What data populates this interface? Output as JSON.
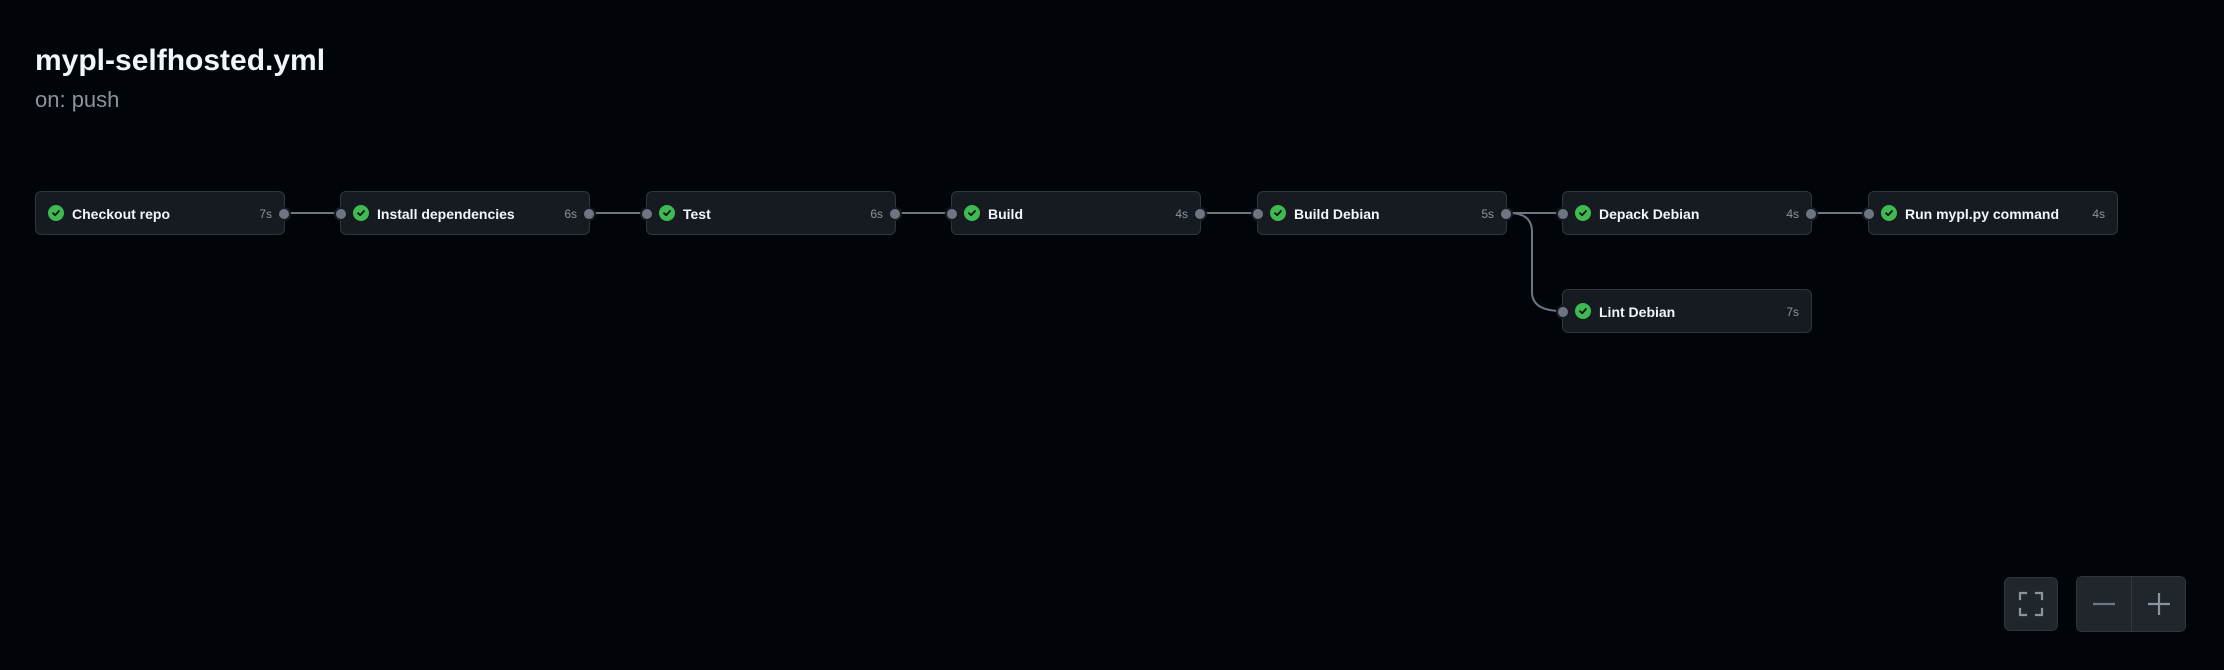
{
  "workflow": {
    "title": "mypl-selfhosted.yml",
    "trigger": "on: push"
  },
  "jobs": [
    {
      "name": "Checkout repo",
      "duration": "7s",
      "status": "success"
    },
    {
      "name": "Install dependencies",
      "duration": "6s",
      "status": "success"
    },
    {
      "name": "Test",
      "duration": "6s",
      "status": "success"
    },
    {
      "name": "Build",
      "duration": "4s",
      "status": "success"
    },
    {
      "name": "Build Debian",
      "duration": "5s",
      "status": "success"
    },
    {
      "name": "Depack Debian",
      "duration": "4s",
      "status": "success"
    },
    {
      "name": "Run mypl.py command",
      "duration": "4s",
      "status": "success"
    },
    {
      "name": "Lint Debian",
      "duration": "7s",
      "status": "success"
    }
  ],
  "controls": {
    "fit_icon": "fullscreen-icon",
    "zoom_out_icon": "minus-icon",
    "zoom_in_icon": "plus-icon"
  },
  "colors": {
    "background": "#010409",
    "card": "#161b22",
    "border": "#30363d",
    "success": "#3fb950",
    "connector": "#6e7681"
  }
}
